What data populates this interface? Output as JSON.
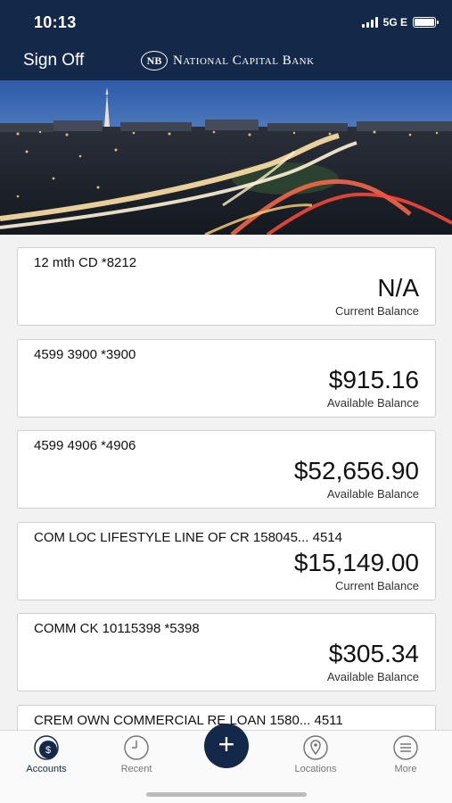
{
  "status": {
    "time": "10:13",
    "network": "5G E"
  },
  "header": {
    "sign_off": "Sign Off",
    "logo_mark": "NB",
    "bank_name": "National Capital Bank"
  },
  "accounts": [
    {
      "name": "12 mth CD *8212",
      "amount": "N/A",
      "label": "Current Balance"
    },
    {
      "name": "4599 3900 *3900",
      "amount": "$915.16",
      "label": "Available Balance"
    },
    {
      "name": "4599 4906 *4906",
      "amount": "$52,656.90",
      "label": "Available Balance"
    },
    {
      "name": "COM LOC LIFESTYLE LINE OF CR 158045... 4514",
      "amount": "$15,149.00",
      "label": "Current Balance"
    },
    {
      "name": "COMM CK 10115398 *5398",
      "amount": "$305.34",
      "label": "Available Balance"
    },
    {
      "name": "CREM OWN COMMERCIAL RE LOAN 1580... 4511",
      "amount": "",
      "label": ""
    }
  ],
  "tabs": [
    {
      "label": "Accounts",
      "icon": "dollar-icon"
    },
    {
      "label": "Recent",
      "icon": "clock-icon"
    },
    {
      "label": "",
      "icon": "plus-icon"
    },
    {
      "label": "Locations",
      "icon": "location-pin-icon"
    },
    {
      "label": "More",
      "icon": "menu-icon"
    }
  ],
  "colors": {
    "header": "#14294a",
    "background": "#f2f2f2",
    "accent": "#14294a"
  }
}
